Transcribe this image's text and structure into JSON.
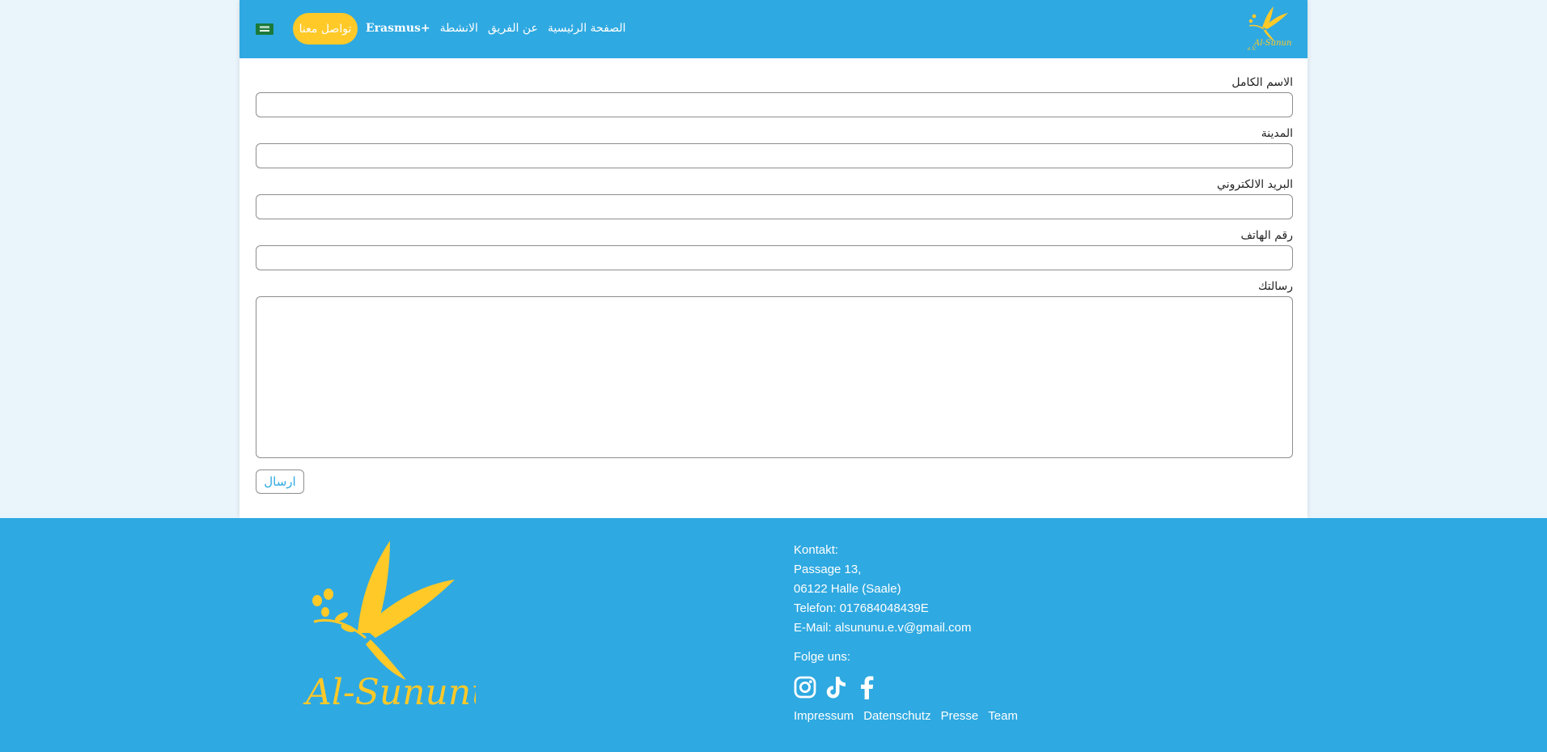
{
  "colors": {
    "brand_blue": "#2fa9e1",
    "accent_yellow": "#ffc928",
    "background": "#eaf5fb"
  },
  "nav": {
    "flag_icon": "saudi-flag-icon",
    "contact_label": "تواصل معنا",
    "links": [
      {
        "label": "Erasmus+"
      },
      {
        "label": "الانشطة"
      },
      {
        "label": "عن الفريق"
      },
      {
        "label": "الصفحة الرئيسية"
      }
    ],
    "logo_icon": "al-sununu-logo"
  },
  "form": {
    "fields": [
      {
        "label": "الاسم الكامل",
        "value": ""
      },
      {
        "label": "المدينة",
        "value": ""
      },
      {
        "label": "البريد الالكتروني",
        "value": ""
      },
      {
        "label": "رقم الهاتف",
        "value": ""
      }
    ],
    "message_label": "رسالتك",
    "message_value": "",
    "submit_label": "ارسال"
  },
  "footer": {
    "logo_text": "Al-Sununu e.V.",
    "contact_lines": [
      "Kontakt:",
      "Passage 13,",
      "06122 Halle (Saale)",
      "Telefon: 017684048439E",
      "E-Mail: alsununu.e.v@gmail.com"
    ],
    "follow_label": "Folge uns:",
    "socials": [
      "instagram-icon",
      "tiktok-icon",
      "facebook-icon"
    ],
    "links": [
      "Impressum",
      "Datenschutz",
      "Presse",
      "Team"
    ]
  }
}
